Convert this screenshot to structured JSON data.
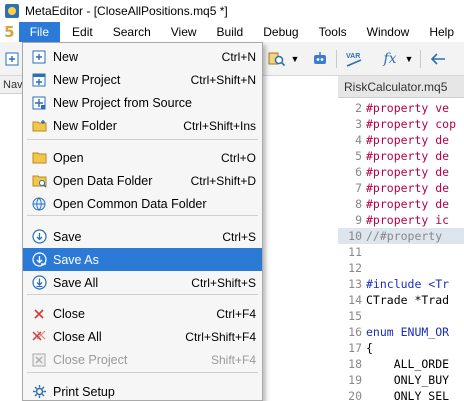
{
  "window": {
    "title": "MetaEditor - [CloseAllPositions.mq5 *]"
  },
  "menubar": {
    "five": "5",
    "items": [
      {
        "label": "File",
        "active": true
      },
      {
        "label": "Edit"
      },
      {
        "label": "Search"
      },
      {
        "label": "View"
      },
      {
        "label": "Build"
      },
      {
        "label": "Debug"
      },
      {
        "label": "Tools"
      },
      {
        "label": "Window"
      },
      {
        "label": "Help"
      }
    ]
  },
  "toolbar": {
    "var_label": "VAR",
    "fx_label": "fx"
  },
  "navigator": {
    "header": "Nav"
  },
  "editor": {
    "tab_label": "RiskCalculator.mq5",
    "lines": [
      {
        "n": "2",
        "text": "#property ve",
        "kind": "prop"
      },
      {
        "n": "3",
        "text": "#property cop",
        "kind": "prop"
      },
      {
        "n": "4",
        "text": "#property de",
        "kind": "prop"
      },
      {
        "n": "5",
        "text": "#property de",
        "kind": "prop"
      },
      {
        "n": "6",
        "text": "#property de",
        "kind": "prop"
      },
      {
        "n": "7",
        "text": "#property de",
        "kind": "prop"
      },
      {
        "n": "8",
        "text": "#property de",
        "kind": "prop"
      },
      {
        "n": "9",
        "text": "#property ic",
        "kind": "prop"
      },
      {
        "n": "10",
        "text": "//#property",
        "kind": "cmt",
        "highlight": true
      },
      {
        "n": "11",
        "text": "",
        "kind": "plain"
      },
      {
        "n": "12",
        "text": "",
        "kind": "plain"
      },
      {
        "n": "13",
        "text": "#include <Tr",
        "kind": "inc"
      },
      {
        "n": "14",
        "text": "CTrade *Trad",
        "kind": "plain"
      },
      {
        "n": "15",
        "text": "",
        "kind": "plain"
      },
      {
        "n": "16",
        "text": "enum ENUM_OR",
        "kind": "enum"
      },
      {
        "n": "17",
        "text": "{",
        "kind": "plain"
      },
      {
        "n": "18",
        "text": "    ALL_ORDE",
        "kind": "plain"
      },
      {
        "n": "19",
        "text": "    ONLY_BUY",
        "kind": "plain"
      },
      {
        "n": "20",
        "text": "    ONLY_SEL",
        "kind": "plain"
      }
    ]
  },
  "file_menu": {
    "items": [
      {
        "label": "New",
        "shortcut": "Ctrl+N",
        "icon": "new-file-icon"
      },
      {
        "label": "New Project",
        "shortcut": "Ctrl+Shift+N",
        "icon": "new-project-icon"
      },
      {
        "label": "New Project from Source",
        "shortcut": "",
        "icon": "project-from-source-icon"
      },
      {
        "label": "New Folder",
        "shortcut": "Ctrl+Shift+Ins",
        "icon": "new-folder-icon"
      },
      {
        "sep": true
      },
      {
        "label": "Open",
        "shortcut": "Ctrl+O",
        "icon": "open-folder-icon"
      },
      {
        "label": "Open Data Folder",
        "shortcut": "Ctrl+Shift+D",
        "icon": "data-folder-icon"
      },
      {
        "label": "Open Common Data Folder",
        "shortcut": "",
        "icon": "common-folder-icon"
      },
      {
        "sep": true
      },
      {
        "label": "Save",
        "shortcut": "Ctrl+S",
        "icon": "save-icon"
      },
      {
        "label": "Save As",
        "shortcut": "",
        "icon": "save-as-icon",
        "selected": true
      },
      {
        "label": "Save All",
        "shortcut": "Ctrl+Shift+S",
        "icon": "save-all-icon"
      },
      {
        "sep": true
      },
      {
        "label": "Close",
        "shortcut": "Ctrl+F4",
        "icon": "close-icon"
      },
      {
        "label": "Close All",
        "shortcut": "Ctrl+Shift+F4",
        "icon": "close-all-icon"
      },
      {
        "label": "Close Project",
        "shortcut": "Shift+F4",
        "icon": "close-project-icon",
        "disabled": true
      },
      {
        "sep": true
      },
      {
        "label": "Print Setup",
        "shortcut": "",
        "icon": "print-setup-icon"
      }
    ]
  },
  "colors": {
    "accent": "#2a7ad6",
    "menu_bg": "#f6f6f6",
    "keyword_property": "#b3004b",
    "keyword_include": "#1a2eb8"
  }
}
